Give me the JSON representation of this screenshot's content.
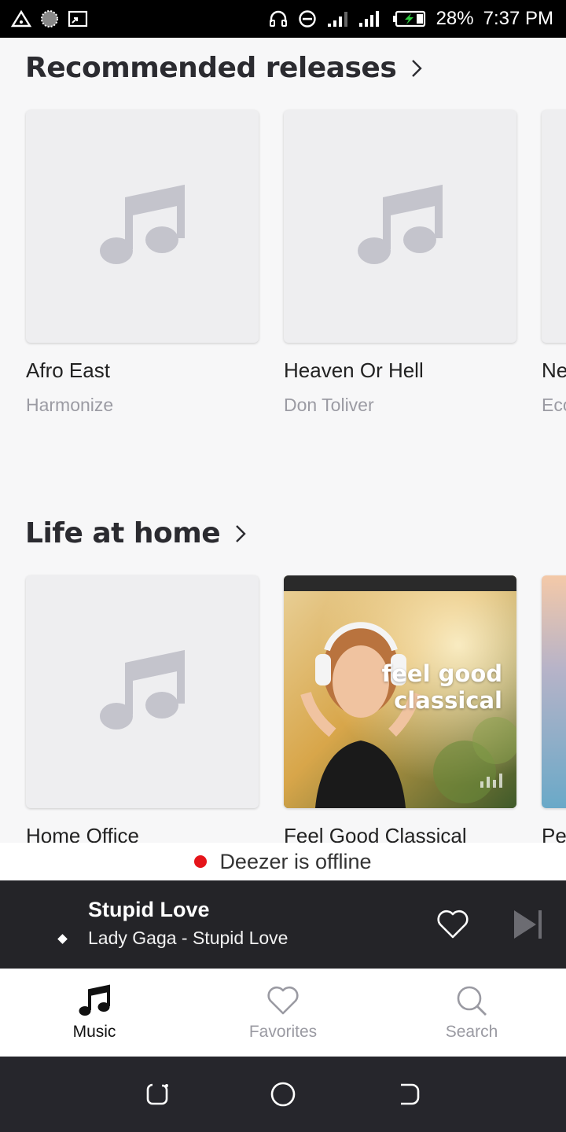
{
  "status_bar": {
    "battery": "28%",
    "time": "7:37 PM",
    "icons": [
      "warning-triangle-icon",
      "ring-icon",
      "cast-icon",
      "headphones-icon",
      "do-not-disturb-icon",
      "signal-icon",
      "signal-icon",
      "battery-charging-icon"
    ]
  },
  "sections": [
    {
      "title": "Recommended releases",
      "items": [
        {
          "title": "Afro East",
          "subtitle": "Harmonize"
        },
        {
          "title": "Heaven Or Hell",
          "subtitle": "Don Toliver"
        },
        {
          "title": "Ne",
          "subtitle": "Eco"
        }
      ]
    },
    {
      "title": "Life at home",
      "items": [
        {
          "title": "Home Office"
        },
        {
          "title": "Feel Good Classical",
          "cover_text_line1": "feel good",
          "cover_text_line2": "classical"
        },
        {
          "title": "Pe"
        }
      ]
    }
  ],
  "offline_banner": {
    "text": "Deezer is offline",
    "dot_color": "#e5141a"
  },
  "player": {
    "title": "Stupid Love",
    "artist": "Lady Gaga - Stupid Love"
  },
  "tabs": [
    {
      "label": "Music",
      "icon": "music-note-icon",
      "active": true
    },
    {
      "label": "Favorites",
      "icon": "heart-icon",
      "active": false
    },
    {
      "label": "Search",
      "icon": "search-icon",
      "active": false
    }
  ],
  "colors": {
    "accent_dark": "#242428",
    "placeholder": "#c4c4cc"
  }
}
